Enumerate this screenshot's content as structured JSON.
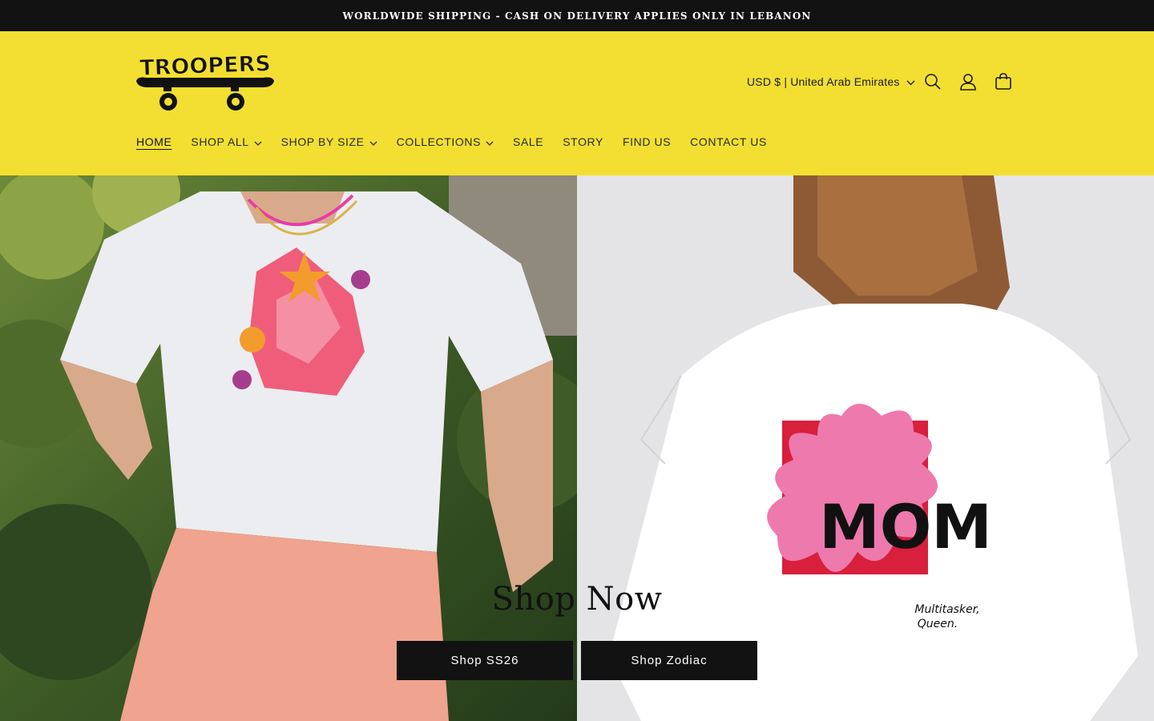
{
  "announcement": "WORLDWIDE SHIPPING - CASH ON DELIVERY APPLIES ONLY IN LEBANON",
  "brand": {
    "logo_text": "TROOPERS"
  },
  "header": {
    "locale_label": "USD $ | United Arab Emirates",
    "icons": [
      "search-icon",
      "account-icon",
      "cart-icon"
    ]
  },
  "nav": {
    "items": [
      {
        "label": "HOME",
        "active": true,
        "dropdown": false
      },
      {
        "label": "SHOP ALL",
        "dropdown": true
      },
      {
        "label": "SHOP BY SIZE",
        "dropdown": true
      },
      {
        "label": "COLLECTIONS",
        "dropdown": true
      },
      {
        "label": "SALE",
        "dropdown": false
      },
      {
        "label": "STORY",
        "dropdown": false
      },
      {
        "label": "FIND US",
        "dropdown": false
      },
      {
        "label": "CONTACT US",
        "dropdown": false
      }
    ]
  },
  "hero": {
    "heading": "Shop Now",
    "buttons": [
      "Shop SS26",
      "Shop Zodiac"
    ],
    "right_print": {
      "word": "MOM",
      "caption_line1": "Multitasker,",
      "caption_line2": "Queen."
    }
  },
  "colors": {
    "announcement_bg": "#121212",
    "header_bg": "#f2df31",
    "button_bg": "#121212"
  }
}
